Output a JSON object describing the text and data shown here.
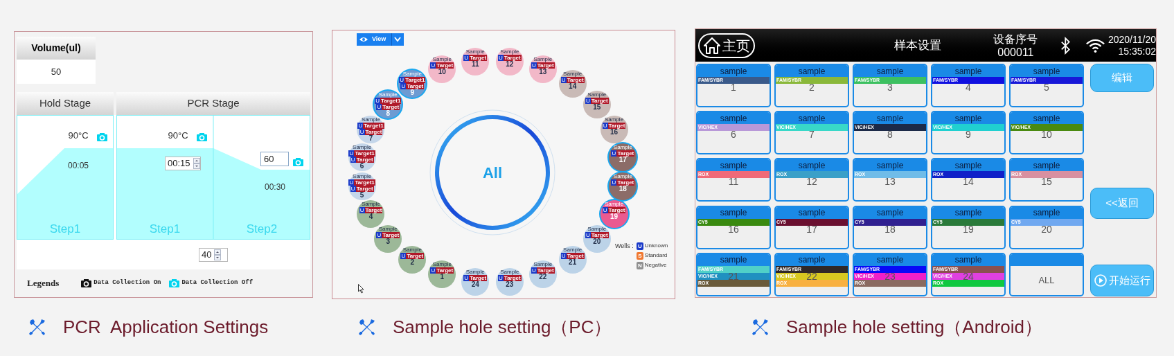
{
  "pcr_settings": {
    "volume": {
      "label": "Volume(ul)",
      "value": "50"
    },
    "stages": [
      {
        "name": "Hold Stage",
        "steps": [
          {
            "label": "Step1",
            "temperature": "90°C",
            "temperature_editing": false,
            "time": "00:05",
            "time_editing": false,
            "data_collection": false
          }
        ]
      },
      {
        "name": "PCR Stage",
        "cycles": "40",
        "steps": [
          {
            "label": "Step1",
            "temperature": "90°C",
            "temperature_editing": false,
            "time": "00:15",
            "time_editing": true,
            "data_collection": false
          },
          {
            "label": "Step2",
            "temperature": "60",
            "temperature_editing": true,
            "time": "00:30",
            "time_editing": false,
            "data_collection": false
          }
        ]
      }
    ],
    "legend": {
      "title": "Legends",
      "items": [
        {
          "label": "Data Collection On",
          "on": true
        },
        {
          "label": "Data Collection Off",
          "on": false
        }
      ]
    },
    "caption": "PCR  Application Settings"
  },
  "plate_view": {
    "view_button": "View",
    "center_label": "All",
    "wells": [
      {
        "number": "11",
        "sample": "Sample",
        "color": "#f2b8c8",
        "selected": false,
        "targets": [
          {
            "badge": "U",
            "name": "Target"
          }
        ]
      },
      {
        "number": "12",
        "sample": "Sample",
        "color": "#f2b8c8",
        "selected": false,
        "targets": [
          {
            "badge": "U",
            "name": "Target"
          }
        ]
      },
      {
        "number": "10",
        "sample": "Sample",
        "color": "#f2b8c8",
        "selected": false,
        "targets": [
          {
            "badge": "U",
            "name": "Target"
          }
        ]
      },
      {
        "number": "13",
        "sample": "Sample",
        "color": "#f2b8c8",
        "selected": false,
        "targets": [
          {
            "badge": "U",
            "name": "Target"
          }
        ]
      },
      {
        "number": "9",
        "sample": "Sample",
        "color": "#6d9bd2",
        "selected": true,
        "targets": [
          {
            "badge": "U",
            "name": "Target1"
          },
          {
            "badge": "U",
            "name": "Target"
          }
        ]
      },
      {
        "number": "14",
        "sample": "Sample",
        "color": "#c9bab6",
        "selected": false,
        "targets": [
          {
            "badge": "U",
            "name": "Target"
          }
        ]
      },
      {
        "number": "8",
        "sample": "Sample",
        "color": "#6d9bd2",
        "selected": true,
        "targets": [
          {
            "badge": "U",
            "name": "Target1"
          },
          {
            "badge": "U",
            "name": "Target"
          }
        ]
      },
      {
        "number": "15",
        "sample": "Sample",
        "color": "#c9bab6",
        "selected": false,
        "targets": [
          {
            "badge": "U",
            "name": "Target"
          }
        ]
      },
      {
        "number": "7",
        "sample": "Sample",
        "color": "#c4d6ea",
        "selected": false,
        "targets": [
          {
            "badge": "U",
            "name": "Target1"
          },
          {
            "badge": "U",
            "name": "Target"
          }
        ]
      },
      {
        "number": "16",
        "sample": "Sample",
        "color": "#c9bab6",
        "selected": false,
        "targets": [
          {
            "badge": "U",
            "name": "Target"
          }
        ]
      },
      {
        "number": "6",
        "sample": "Sample",
        "color": "#c4d6ea",
        "selected": false,
        "targets": [
          {
            "badge": "U",
            "name": "Target1"
          },
          {
            "badge": "U",
            "name": "Target"
          }
        ]
      },
      {
        "number": "17",
        "sample": "Sample",
        "color": "#8c6c68",
        "selected": true,
        "targets": [
          {
            "badge": "U",
            "name": "Target"
          }
        ]
      },
      {
        "number": "5",
        "sample": "Sample",
        "color": "#c4d6ea",
        "selected": false,
        "targets": [
          {
            "badge": "U",
            "name": "Target1"
          },
          {
            "badge": "U",
            "name": "Target"
          }
        ]
      },
      {
        "number": "18",
        "sample": "Sample",
        "color": "#8c6c68",
        "selected": true,
        "targets": [
          {
            "badge": "U",
            "name": "Target"
          }
        ]
      },
      {
        "number": "4",
        "sample": "Sample",
        "color": "#9cb898",
        "selected": false,
        "targets": [
          {
            "badge": "U",
            "name": "Target"
          }
        ]
      },
      {
        "number": "19",
        "sample": "Sample",
        "color": "#ea5a90",
        "selected": true,
        "targets": [
          {
            "badge": "U",
            "name": "Target"
          }
        ]
      },
      {
        "number": "3",
        "sample": "Sample",
        "color": "#9cb898",
        "selected": false,
        "targets": [
          {
            "badge": "U",
            "name": "Target"
          }
        ]
      },
      {
        "number": "20",
        "sample": "Sample",
        "color": "#bcd3e8",
        "selected": false,
        "targets": [
          {
            "badge": "U",
            "name": "Target"
          }
        ]
      },
      {
        "number": "2",
        "sample": "Sample",
        "color": "#9cb898",
        "selected": false,
        "targets": [
          {
            "badge": "U",
            "name": "Target"
          }
        ]
      },
      {
        "number": "21",
        "sample": "Sample",
        "color": "#bcd3e8",
        "selected": false,
        "targets": [
          {
            "badge": "U",
            "name": "Target"
          }
        ]
      },
      {
        "number": "1",
        "sample": "Sample",
        "color": "#9cb898",
        "selected": false,
        "targets": [
          {
            "badge": "U",
            "name": "Target"
          }
        ]
      },
      {
        "number": "22",
        "sample": "Sample",
        "color": "#bcd3e8",
        "selected": false,
        "targets": [
          {
            "badge": "U",
            "name": "Target"
          }
        ]
      },
      {
        "number": "24",
        "sample": "Sample",
        "color": "#bcd3e8",
        "selected": false,
        "targets": [
          {
            "badge": "U",
            "name": "Target"
          }
        ]
      },
      {
        "number": "23",
        "sample": "Sample",
        "color": "#bcd3e8",
        "selected": false,
        "targets": [
          {
            "badge": "U",
            "name": "Target"
          }
        ]
      }
    ],
    "legend": {
      "title": "Wells :",
      "items": [
        {
          "badge": "U",
          "label": "Unknown",
          "color": "#1a3ac8"
        },
        {
          "badge": "S",
          "label": "Standard",
          "color": "#f07830"
        },
        {
          "badge": "N",
          "label": "Negative",
          "color": "#909090"
        }
      ]
    },
    "caption": "Sample hole setting（PC）"
  },
  "touch_screen": {
    "home": "主页",
    "title": "样本设置",
    "device_label": "设备序号",
    "device_id": "000011",
    "date": "2020/11/20",
    "time": "15:35:02",
    "cards": [
      {
        "kind": "well",
        "title": "sample",
        "number": "1",
        "channels": [
          {
            "label": "FAM/SYBR",
            "color": "#3a5a8a"
          }
        ]
      },
      {
        "kind": "well",
        "title": "sample",
        "number": "2",
        "channels": [
          {
            "label": "FAM/SYBR",
            "color": "#8ab83a"
          }
        ]
      },
      {
        "kind": "well",
        "title": "sample",
        "number": "3",
        "channels": [
          {
            "label": "FAM/SYBR",
            "color": "#3cc060"
          }
        ]
      },
      {
        "kind": "well",
        "title": "sample",
        "number": "4",
        "channels": [
          {
            "label": "FAM/SYBR",
            "color": "#1010e0"
          }
        ]
      },
      {
        "kind": "well",
        "title": "sample",
        "number": "5",
        "channels": [
          {
            "label": "FAM/SYBR",
            "color": "#1818d8"
          }
        ]
      },
      {
        "kind": "well",
        "title": "sample",
        "number": "6",
        "channels": [
          {
            "label": "VIC/HEX",
            "color": "#b898d8"
          }
        ]
      },
      {
        "kind": "well",
        "title": "sample",
        "number": "7",
        "channels": [
          {
            "label": "VIC/HEX",
            "color": "#38d8c8"
          }
        ]
      },
      {
        "kind": "well",
        "title": "sample",
        "number": "8",
        "channels": [
          {
            "label": "VIC/HEX",
            "color": "#1c2a48"
          }
        ]
      },
      {
        "kind": "well",
        "title": "sample",
        "number": "9",
        "channels": [
          {
            "label": "VIC/HEX",
            "color": "#20d0d0"
          }
        ]
      },
      {
        "kind": "well",
        "title": "sample",
        "number": "10",
        "channels": [
          {
            "label": "VIC/HEX",
            "color": "#4a8a10"
          }
        ]
      },
      {
        "kind": "well",
        "title": "sample",
        "number": "11",
        "channels": [
          {
            "label": "ROX",
            "color": "#f06a78"
          }
        ]
      },
      {
        "kind": "well",
        "title": "sample",
        "number": "12",
        "channels": [
          {
            "label": "ROX",
            "color": "#3aa0c8"
          }
        ]
      },
      {
        "kind": "well",
        "title": "sample",
        "number": "13",
        "channels": [
          {
            "label": "ROX",
            "color": "#70bce8"
          }
        ]
      },
      {
        "kind": "well",
        "title": "sample",
        "number": "14",
        "channels": [
          {
            "label": "ROX",
            "color": "#1020c8"
          }
        ]
      },
      {
        "kind": "well",
        "title": "sample",
        "number": "15",
        "channels": [
          {
            "label": "ROX",
            "color": "#d890a0"
          }
        ]
      },
      {
        "kind": "well",
        "title": "sample",
        "number": "16",
        "channels": [
          {
            "label": "CY5",
            "color": "#3a8a10"
          }
        ]
      },
      {
        "kind": "well",
        "title": "sample",
        "number": "17",
        "channels": [
          {
            "label": "CY5",
            "color": "#6a1030"
          }
        ]
      },
      {
        "kind": "well",
        "title": "sample",
        "number": "18",
        "channels": [
          {
            "label": "CY5",
            "color": "#302090"
          }
        ]
      },
      {
        "kind": "well",
        "title": "sample",
        "number": "19",
        "channels": [
          {
            "label": "CY5",
            "color": "#2a7a3a"
          }
        ]
      },
      {
        "kind": "well",
        "title": "sample",
        "number": "20",
        "channels": [
          {
            "label": "CY5",
            "color": "#70a8f0"
          }
        ]
      },
      {
        "kind": "well",
        "title": "sample",
        "number": "21",
        "channels": [
          {
            "label": "FAM/SYBR",
            "color": "#50d0c8"
          },
          {
            "label": "VIC/HEX",
            "color": "#2090c0"
          },
          {
            "label": "ROX",
            "color": "#6a5a3a"
          }
        ]
      },
      {
        "kind": "well",
        "title": "sample",
        "number": "22",
        "channels": [
          {
            "label": "FAM/SYBR",
            "color": "#302828"
          },
          {
            "label": "VIC/HEX",
            "color": "#d8c820"
          },
          {
            "label": "ROX",
            "color": "#f8b040"
          }
        ]
      },
      {
        "kind": "well",
        "title": "sample",
        "number": "23",
        "channels": [
          {
            "label": "FAM/SYBR",
            "color": "#0808f8"
          },
          {
            "label": "VIC/HEX",
            "color": "#f020c8"
          },
          {
            "label": "ROX",
            "color": "#8a6a60"
          }
        ]
      },
      {
        "kind": "well",
        "title": "sample",
        "number": "24",
        "channels": [
          {
            "label": "FAM/SYBR",
            "color": "#8a5050"
          },
          {
            "label": "VIC/HEX",
            "color": "#e040e0"
          },
          {
            "label": "ROX",
            "color": "#10c840"
          }
        ]
      },
      {
        "kind": "all",
        "number": "ALL"
      }
    ],
    "buttons": [
      {
        "kind": "edit",
        "label": "编辑"
      },
      {
        "kind": "back",
        "label": "<<返回"
      },
      {
        "kind": "run",
        "label": "开始运行"
      }
    ],
    "caption": "Sample hole setting（Android）"
  }
}
